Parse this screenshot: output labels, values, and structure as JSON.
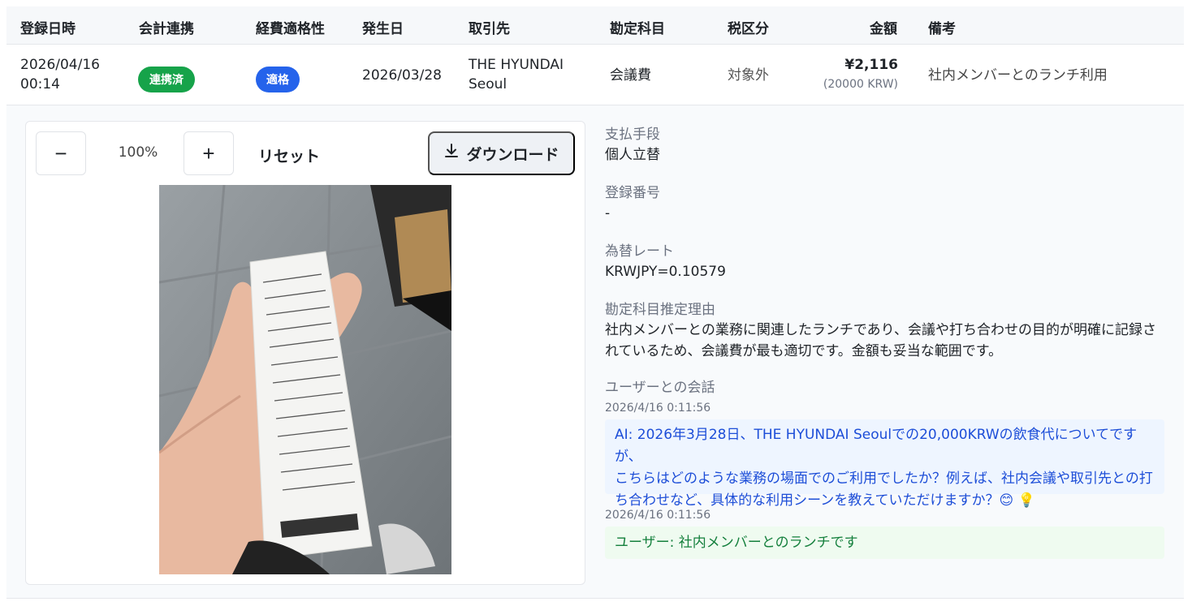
{
  "table": {
    "headers": [
      "登録日時",
      "会計連携",
      "経費適格性",
      "発生日",
      "取引先",
      "勘定科目",
      "税区分",
      "金額",
      "備考"
    ],
    "row": {
      "registered_date": "2026/04/16",
      "registered_time": "00:14",
      "sync_status": "連携済",
      "eligibility": "適格",
      "occurred_date": "2026/03/28",
      "vendor_line1": "THE HYUNDAI",
      "vendor_line2": "Seoul",
      "account": "会議費",
      "tax": "対象外",
      "amount": "¥2,116",
      "amount_original": "(20000 KRW)",
      "note": "社内メンバーとのランチ利用"
    }
  },
  "viewer": {
    "zoom_out": "−",
    "zoom_level": "100%",
    "zoom_in": "+",
    "reset": "リセット",
    "download": "ダウンロード"
  },
  "details": {
    "payment_label": "支払手段",
    "payment_value": "個人立替",
    "regno_label": "登録番号",
    "regno_value": "-",
    "fx_label": "為替レート",
    "fx_value": "KRWJPY=0.10579",
    "reason_label": "勘定科目推定理由",
    "reason_line1": "社内メンバーとの業務に関連したランチであり、会議や打ち合わせの目的が明確に記録さ",
    "reason_line2": "れているため、会議費が最も適切です。金額も妥当な範囲です。",
    "chat_label": "ユーザーとの会話"
  },
  "chat": [
    {
      "time": "2026/4/16 0:11:56",
      "line1": "AI: 2026年3月28日、THE HYUNDAI Seoulでの20,000KRWの飲食代についてですが、",
      "line2": "こちらはどのような業務の場面でのご利用でしたか？例えば、社内会議や取引先との打",
      "line3": "ち合わせなど、具体的な利用シーンを教えていただけますか？😊 💡"
    },
    {
      "time": "2026/4/16 0:11:56",
      "line1": "ユーザー: 社内メンバーとのランチです"
    }
  ],
  "colors": {
    "synced": "#16a34a",
    "eligible": "#2563eb",
    "ai_text": "#1d4ed8",
    "user_text": "#15803d"
  }
}
